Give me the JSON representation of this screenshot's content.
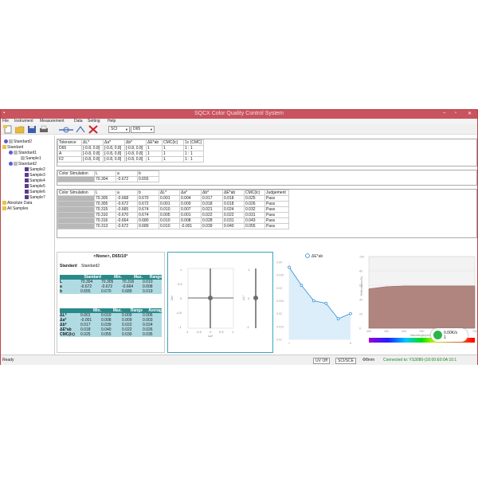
{
  "window": {
    "title": "SQCX Color Quality Control System"
  },
  "menu": [
    "File",
    "Instrument",
    "Measurement",
    "Data",
    "Setting",
    "Help"
  ],
  "toolbar": {
    "mode": "SCI",
    "illuminant": "D65"
  },
  "tree": {
    "standard2_top": "Standard2",
    "standard": "Standard",
    "standard1": "Standard1",
    "sample1": "Sample1",
    "standard2": "Standard2",
    "samples": [
      "Sample2",
      "Sample3",
      "Sample4",
      "Sample5",
      "Sample6",
      "Sample7"
    ],
    "absolute": "Absolute Data",
    "all": "All Samples"
  },
  "tolerance": {
    "headers": [
      "Tolerance",
      "ΔL*",
      "Δa*",
      "Δb*",
      "ΔE*ab",
      "CMC(lc)",
      "1c (CMC)"
    ],
    "rows": [
      [
        "D65",
        "[-0.8, 0.8]",
        "[-0.8, 0.8]",
        "[-0.8, 0.8]",
        "1",
        "1",
        "1 : 1"
      ],
      [
        "A",
        "[-0.8, 0.8]",
        "[-0.8, 0.8]",
        "[-0.8, 0.8]",
        "1",
        "1",
        "1 : 1"
      ],
      [
        "F2",
        "[-0.8, 0.8]",
        "[-0.8, 0.8]",
        "[-0.8, 0.8]",
        "1",
        "1",
        "1 : 1"
      ]
    ]
  },
  "stdsim": {
    "headers": [
      "Color Simulation",
      "L",
      "a",
      "b"
    ],
    "row": [
      "70.304",
      "-0.672",
      "0.655"
    ]
  },
  "samplesim": {
    "headers": [
      "Color Simulation",
      "L",
      "a",
      "b",
      "ΔL*",
      "Δa*",
      "Δb*",
      "ΔE*ab",
      "CMC(lc)",
      "Judgement"
    ],
    "rows": [
      [
        "70.305",
        "-0.668",
        "0.670",
        "0.001",
        "0.004",
        "0.017",
        "0.018",
        "0.025",
        "Pass"
      ],
      [
        "70.305",
        "-0.672",
        "0.672",
        "0.001",
        "0.000",
        "0.018",
        "0.018",
        "0.026",
        "Pass"
      ],
      [
        "70.315",
        "-0.665",
        "0.674",
        "0.010",
        "0.007",
        "0.021",
        "0.024",
        "0.032",
        "Pass"
      ],
      [
        "70.310",
        "-0.670",
        "0.674",
        "0.005",
        "0.001",
        "0.022",
        "0.022",
        "0.031",
        "Pass"
      ],
      [
        "70.316",
        "-0.664",
        "0.680",
        "0.010",
        "0.008",
        "0.028",
        "0.031",
        "0.043",
        "Pass"
      ],
      [
        "70.313",
        "-0.672",
        "0.689",
        "0.010",
        "-0.001",
        "0.039",
        "0.040",
        "0.055",
        "Pass"
      ]
    ]
  },
  "stats": {
    "title": "<None>, D65/10°",
    "std_label": "Standard",
    "std_name": "Standard2",
    "t1_headers": [
      "",
      "Standard",
      "Min.",
      "Max.",
      "Range"
    ],
    "t1_rows": [
      [
        "L",
        "70.304",
        "70.305",
        "70.316",
        "0.010"
      ],
      [
        "a",
        "-0.672",
        "-0.672",
        "-0.664",
        "0.008"
      ],
      [
        "b",
        "0.655",
        "0.670",
        "0.689",
        "0.019"
      ]
    ],
    "t2_headers": [
      "",
      "Min.",
      "Max.",
      "Range",
      "Averag"
    ],
    "t2_rows": [
      [
        "ΔL*",
        "0.001",
        "0.010",
        "0.009",
        "0.006"
      ],
      [
        "Δa*",
        "-0.001",
        "0.008",
        "0.009",
        "0.003"
      ],
      [
        "Δb*",
        "0.017",
        "0.039",
        "0.022",
        "0.024"
      ],
      [
        "ΔE*ab",
        "0.018",
        "0.040",
        "0.022",
        "0.026"
      ],
      [
        "CMC(lc)",
        "0.025",
        "0.055",
        "0.030",
        "0.035"
      ]
    ]
  },
  "scatter": {
    "ticks_x": [
      "-1",
      "-0.5",
      "0",
      "0.5",
      "1"
    ],
    "ticks_y": [
      "1",
      "0.5",
      "0",
      "-0.5",
      "-1"
    ],
    "xlabel": "Δa*",
    "ylabel": "Δb*",
    "ylabel2": "ΔL*",
    "ticks_y2": [
      "1",
      "0",
      "-1"
    ]
  },
  "chart_data": [
    {
      "type": "line",
      "title": "ΔE*ab",
      "x": [
        1,
        2,
        3,
        4,
        5,
        6
      ],
      "series": [
        {
          "name": "ΔE*ab",
          "values": [
            0.038,
            0.031,
            0.025,
            0.024,
            0.018,
            0.02
          ]
        }
      ],
      "ylim": [
        0.01,
        0.04
      ],
      "yticks": [
        "0.04",
        "0.035",
        "0.03",
        "0.025",
        "0.02",
        "0.015",
        "0.01"
      ],
      "xticks": [
        "1",
        "6"
      ]
    },
    {
      "type": "area",
      "x": [
        400,
        450,
        500,
        550,
        600,
        650,
        700
      ],
      "series": [
        {
          "values": [
            55,
            58,
            59,
            59,
            59,
            59,
            59
          ]
        }
      ],
      "ylim": [
        0,
        100
      ],
      "xlim": [
        400,
        700
      ],
      "ylabel": "Reflectance(%)",
      "xlabel": "Wavelength(nm)",
      "yticks": [
        "100",
        "80",
        "60",
        "40",
        "20",
        "0"
      ],
      "xticks": [
        "400",
        "450",
        "500",
        "550",
        "600",
        "650",
        "700"
      ]
    }
  ],
  "net": {
    "up": "0.00K/s",
    "down": "1"
  },
  "status": {
    "ready": "Ready",
    "uv": "UV Off",
    "sci": "SCI/SCE",
    "aperture": "Φ8mm",
    "connected": "Connected to: YS3080-(16:00:E0:0A:10:1"
  }
}
